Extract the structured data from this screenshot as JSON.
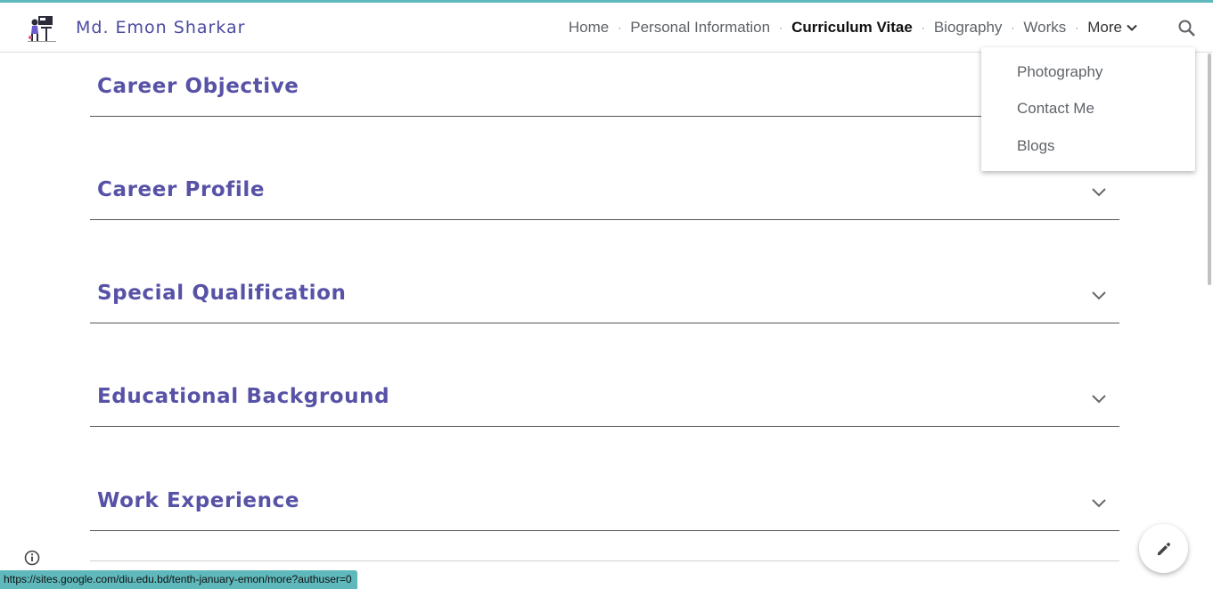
{
  "header": {
    "site_title": "Md. Emon Sharkar",
    "nav": {
      "home": "Home",
      "personal_information": "Personal Information",
      "curriculum_vitae": "Curriculum Vitae",
      "biography": "Biography",
      "works": "Works",
      "more": "More",
      "separator": "·"
    }
  },
  "more_menu": {
    "items": [
      "Photography",
      "Contact Me",
      "Blogs"
    ]
  },
  "sections": [
    {
      "title": "Career Objective"
    },
    {
      "title": "Career Profile"
    },
    {
      "title": "Special Qualification"
    },
    {
      "title": "Educational Background"
    },
    {
      "title": "Work Experience"
    }
  ],
  "status_bar": {
    "url": "https://sites.google.com/diu.edu.bd/tenth-january-emon/more?authuser=0"
  },
  "colors": {
    "accent": "#5fb8bc",
    "heading": "#5752a6",
    "title": "#4a4aa0"
  },
  "icons": [
    "logo-icon",
    "chevron-down-icon",
    "search-icon",
    "info-icon",
    "edit-pencil-icon"
  ]
}
